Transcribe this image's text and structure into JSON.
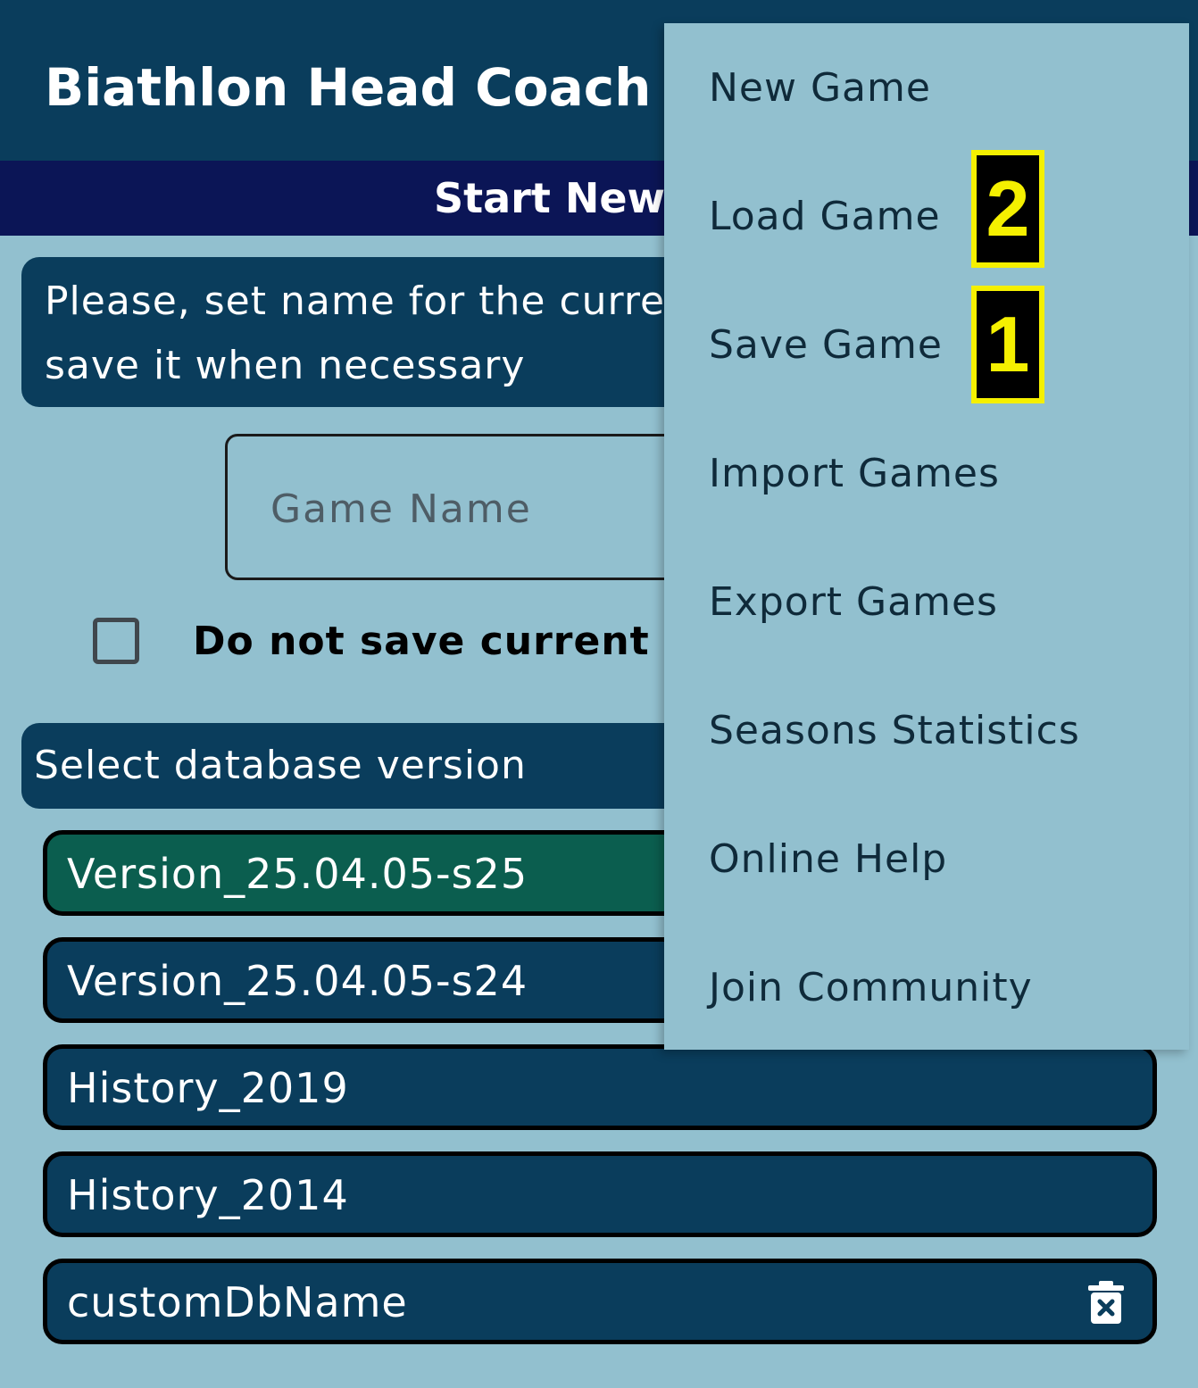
{
  "app": {
    "title": "Biathlon Head Coach"
  },
  "screen": {
    "title": "Start New G"
  },
  "info": {
    "text": "Please, set name for the current game to be able to save it when necessary"
  },
  "game_name": {
    "placeholder": "Game Name",
    "value": ""
  },
  "checkbox": {
    "label": "Do not save current game",
    "checked": false
  },
  "database": {
    "header": "Select database version",
    "items": [
      {
        "label": "Version_25.04.05-s25",
        "selected": true
      },
      {
        "label": "Version_25.04.05-s24",
        "selected": false
      },
      {
        "label": "History_2019",
        "selected": false
      },
      {
        "label": "History_2014",
        "selected": false
      },
      {
        "label": "customDbName",
        "selected": false,
        "icon": "trash-icon"
      }
    ]
  },
  "menu": {
    "items": [
      "New Game",
      "Load Game",
      "Save Game",
      "Import Games",
      "Export Games",
      "Seasons Statistics",
      "Online Help",
      "Join Community"
    ]
  },
  "badges": {
    "load": "2",
    "save": "1"
  },
  "colors": {
    "primary": "#0a3d5c",
    "secondary_bar": "#0b1556",
    "background": "#92c0cf",
    "selected": "#0b5e4f",
    "badge": "#f5f000"
  }
}
